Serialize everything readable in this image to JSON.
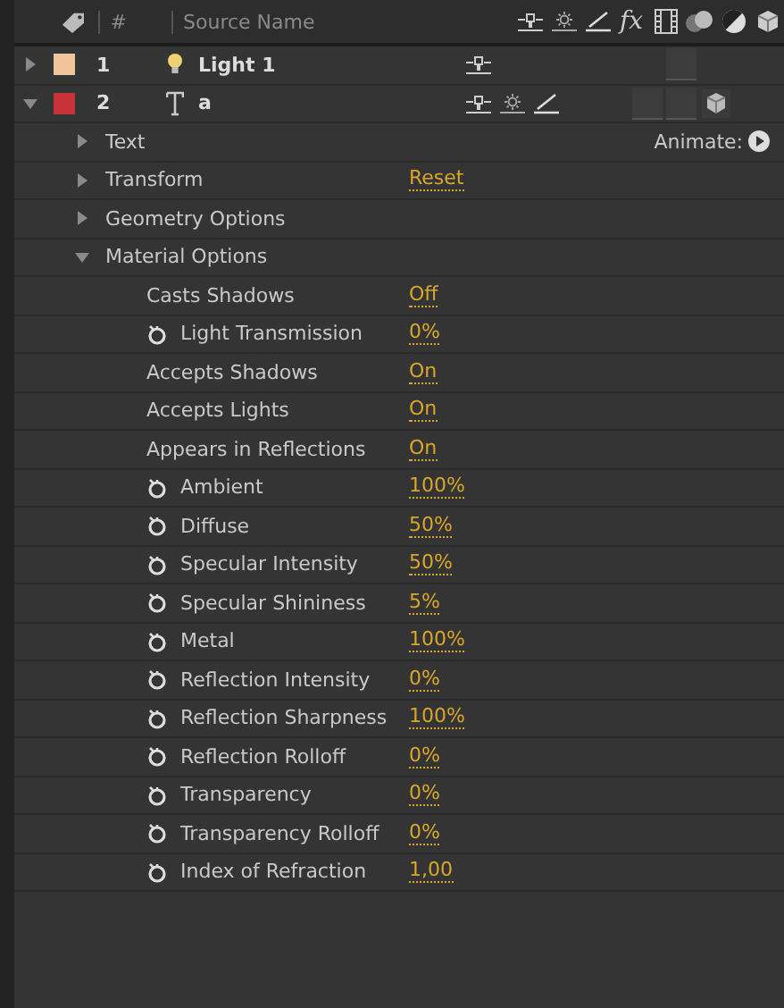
{
  "header": {
    "number_label": "#",
    "source_label": "Source Name",
    "fx_label": "fx"
  },
  "layers": [
    {
      "number": "1",
      "name": "Light 1",
      "kind": "light",
      "color": "#f2c49c",
      "expanded": false,
      "switches": [
        {
          "kind": "shy"
        },
        {
          "kind": "blank"
        },
        {
          "kind": "blank"
        },
        {
          "kind": "blank"
        },
        {
          "kind": "blank"
        },
        {
          "kind": "blank"
        },
        {
          "kind": "off"
        },
        {
          "kind": "blank"
        }
      ]
    },
    {
      "number": "2",
      "name": "a",
      "kind": "text",
      "color": "#c8343a",
      "expanded": true,
      "switches": [
        {
          "kind": "shy"
        },
        {
          "kind": "collapse"
        },
        {
          "kind": "quality"
        },
        {
          "kind": "blank"
        },
        {
          "kind": "blank"
        },
        {
          "kind": "off"
        },
        {
          "kind": "off"
        },
        {
          "kind": "threed"
        }
      ],
      "children": [
        {
          "name": "Text",
          "expanded": false,
          "action": "Animate:"
        },
        {
          "name": "Transform",
          "expanded": false,
          "value": "Reset"
        },
        {
          "name": "Geometry Options",
          "expanded": false
        },
        {
          "name": "Material Options",
          "expanded": true,
          "children": [
            {
              "name": "Casts Shadows",
              "stopwatch": false,
              "value": "Off"
            },
            {
              "name": "Light Transmission",
              "stopwatch": true,
              "value": "0%"
            },
            {
              "name": "Accepts Shadows",
              "stopwatch": false,
              "value": "On"
            },
            {
              "name": "Accepts Lights",
              "stopwatch": false,
              "value": "On"
            },
            {
              "name": "Appears in Reflections",
              "stopwatch": false,
              "value": "On"
            },
            {
              "name": "Ambient",
              "stopwatch": true,
              "value": "100%"
            },
            {
              "name": "Diffuse",
              "stopwatch": true,
              "value": "50%"
            },
            {
              "name": "Specular Intensity",
              "stopwatch": true,
              "value": "50%"
            },
            {
              "name": "Specular Shininess",
              "stopwatch": true,
              "value": "5%"
            },
            {
              "name": "Metal",
              "stopwatch": true,
              "value": "100%"
            },
            {
              "name": "Reflection Intensity",
              "stopwatch": true,
              "value": "0%"
            },
            {
              "name": "Reflection Sharpness",
              "stopwatch": true,
              "value": "100%"
            },
            {
              "name": "Reflection Rolloff",
              "stopwatch": true,
              "value": "0%"
            },
            {
              "name": "Transparency",
              "stopwatch": true,
              "value": "0%"
            },
            {
              "name": "Transparency Rolloff",
              "stopwatch": true,
              "value": "0%"
            },
            {
              "name": "Index of Refraction",
              "stopwatch": true,
              "value": "1,00"
            }
          ]
        }
      ]
    }
  ]
}
